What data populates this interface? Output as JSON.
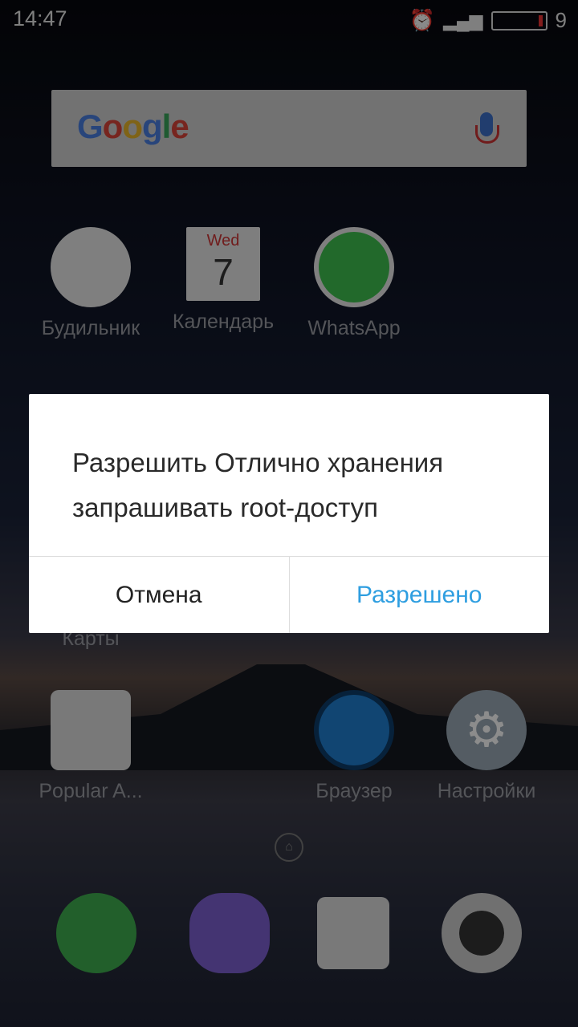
{
  "status_bar": {
    "time": "14:47",
    "battery_level": "9",
    "icons": [
      "alarm-icon",
      "signal-h-plus-icon",
      "battery-icon"
    ]
  },
  "search": {
    "logo": "Google",
    "icon": "mic-icon"
  },
  "apps": [
    {
      "label": "Будильник",
      "icon": "clock-icon"
    },
    {
      "label": "Календарь",
      "icon": "calendar-icon",
      "day": "Wed",
      "date": "7"
    },
    {
      "label": "WhatsApp",
      "icon": "whatsapp-icon"
    },
    {
      "label": "Карты",
      "icon": "maps-icon"
    },
    {
      "label": "Popular A...",
      "icon": "folder-icon"
    },
    {
      "label": "Браузер",
      "icon": "browser-icon"
    },
    {
      "label": "Настройки",
      "icon": "settings-icon"
    }
  ],
  "dock": [
    "phone-icon",
    "viber-icon",
    "navigator-icon",
    "camera-icon"
  ],
  "dialog": {
    "message": "Разрешить Отлично хранения запрашивать root-доступ",
    "cancel": "Отмена",
    "allow": "Разрешено"
  },
  "colors": {
    "accent": "#2e9ee0"
  }
}
